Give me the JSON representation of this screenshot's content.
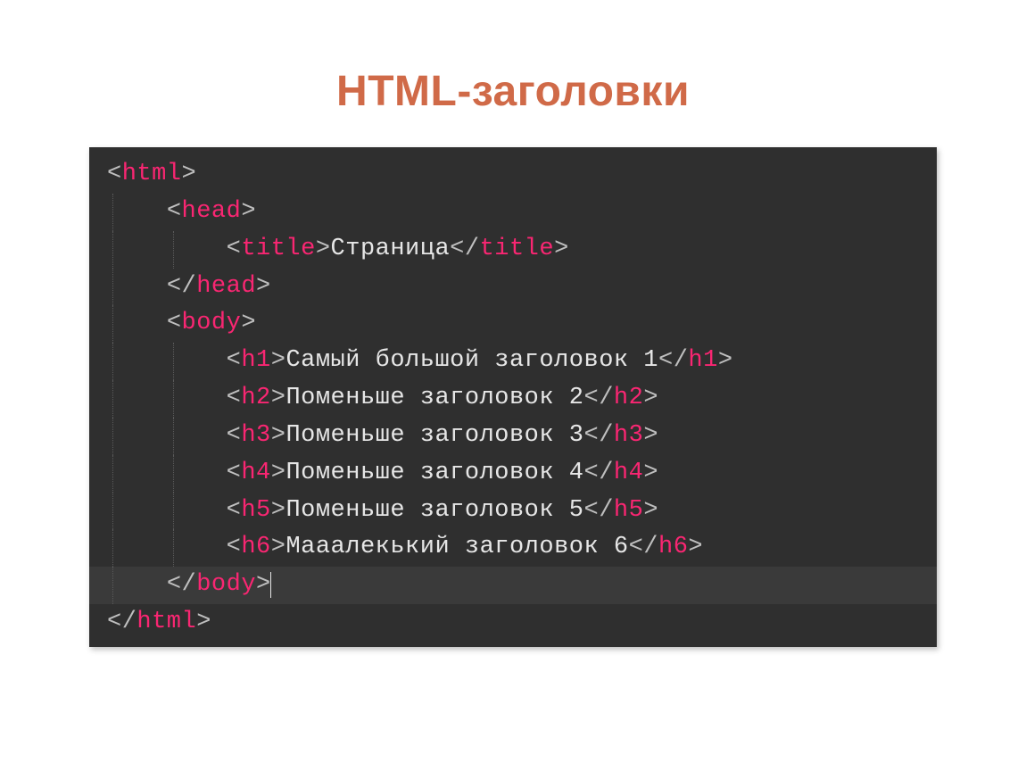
{
  "slide": {
    "title": "HTML-заголовки"
  },
  "code": {
    "tags": {
      "html": "html",
      "head": "head",
      "title": "title",
      "body": "body",
      "h1": "h1",
      "h2": "h2",
      "h3": "h3",
      "h4": "h4",
      "h5": "h5",
      "h6": "h6"
    },
    "text": {
      "title_inner": "Страница",
      "h1_inner": "Самый большой заголовок 1",
      "h2_inner": "Поменьше заголовок 2",
      "h3_inner": "Поменьше заголовок 3",
      "h4_inner": "Поменьше заголовок 4",
      "h5_inner": "Поменьше заголовок 5",
      "h6_inner": "Мааалекький заголовок 6",
      "h6_inner_actual": "Мааалекький заголовок 6"
    },
    "text_h6": "Мааалекький заголовок 6"
  },
  "content": {
    "title_text": "Страница",
    "h1": "Самый большой заголовок 1",
    "h2": "Поменьше заголовок 2",
    "h3": "Поменьше заголовок 3",
    "h4": "Поменьше заголовок 4",
    "h5": "Поменьше заголовок 5",
    "h6": "Мааалекький заголовок 6"
  },
  "h6_display": "Мааалекький заголовок 6",
  "h6_real": "Мааалекький заголовок 6"
}
